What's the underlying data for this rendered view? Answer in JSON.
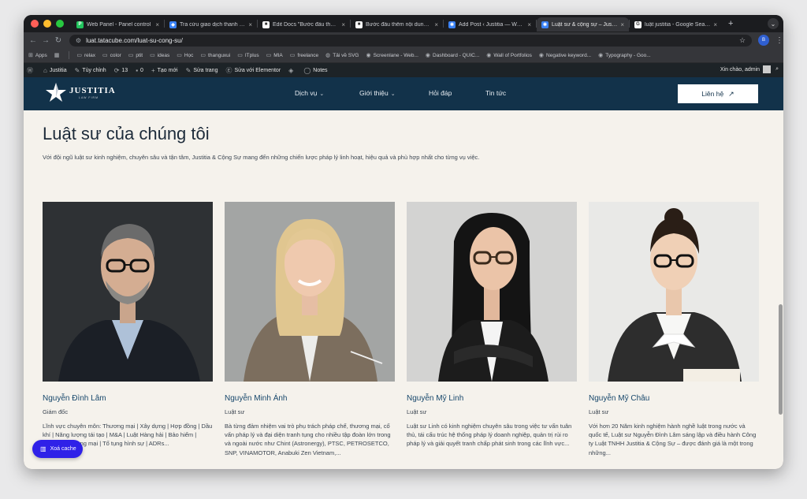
{
  "browser": {
    "tabs": [
      {
        "title": "Web Panel - Panel control",
        "favicon_color": "#22c55e",
        "favicon_glyph": "P",
        "active": false
      },
      {
        "title": "Tra cứu giao dịch thanh toán",
        "favicon_color": "#3b82f6",
        "favicon_glyph": "◆",
        "active": false
      },
      {
        "title": "Edit Docs \"Bước đầu thêm n",
        "favicon_color": "#ffffff",
        "favicon_glyph": "■",
        "active": false
      },
      {
        "title": "Bước đầu thêm nội dung – Tr",
        "favicon_color": "#ffffff",
        "favicon_glyph": "■",
        "active": false
      },
      {
        "title": "Add Post ‹ Justitia — WordP",
        "favicon_color": "#3b82f6",
        "favicon_glyph": "✱",
        "active": false
      },
      {
        "title": "Luật sư & cộng sự – Justitia",
        "favicon_color": "#3b82f6",
        "favicon_glyph": "✱",
        "active": true
      },
      {
        "title": "luật justitia - Google Search",
        "favicon_color": "#ffffff",
        "favicon_glyph": "G",
        "active": false
      }
    ],
    "new_tab": "+",
    "url": "luat.tatacube.com/luat-su-cong-su/",
    "profile_initial": "B"
  },
  "bookmarks": {
    "apps": "Apps",
    "items": [
      {
        "label": "relax",
        "icon": "folder-icon"
      },
      {
        "label": "color",
        "icon": "folder-icon"
      },
      {
        "label": "ptit",
        "icon": "folder-icon"
      },
      {
        "label": "ideas",
        "icon": "folder-icon"
      },
      {
        "label": "Học",
        "icon": "folder-icon"
      },
      {
        "label": "thanguxui",
        "icon": "folder-icon"
      },
      {
        "label": "ITplus",
        "icon": "folder-icon"
      },
      {
        "label": "MIA",
        "icon": "folder-icon"
      },
      {
        "label": "freelance",
        "icon": "folder-icon"
      },
      {
        "label": "Tải về SVG",
        "icon": "globe-icon"
      },
      {
        "label": "Screenlane - Web...",
        "icon": "site-icon"
      },
      {
        "label": "Dashboard - QUIC...",
        "icon": "site-icon"
      },
      {
        "label": "Wall of Portfolios",
        "icon": "site-icon"
      },
      {
        "label": "Negative keyword...",
        "icon": "site-icon"
      },
      {
        "label": "Typography - Goo...",
        "icon": "site-icon"
      }
    ]
  },
  "adminbar": {
    "items": [
      {
        "label": "",
        "icon": "wordpress-icon",
        "glyph": "Ⓦ"
      },
      {
        "label": "Justitia",
        "icon": "home-icon",
        "glyph": "⌂"
      },
      {
        "label": "Tùy chỉnh",
        "icon": "brush-icon",
        "glyph": "✎"
      },
      {
        "label": "13",
        "icon": "refresh-icon",
        "glyph": "⟳"
      },
      {
        "label": "0",
        "icon": "comment-icon",
        "glyph": "▪"
      },
      {
        "label": "Tạo mới",
        "icon": "plus-icon",
        "glyph": "+"
      },
      {
        "label": "Sửa trang",
        "icon": "pencil-icon",
        "glyph": "✎"
      },
      {
        "label": "Sửa với Elementor",
        "icon": "elementor-icon",
        "glyph": "Ⓔ"
      },
      {
        "label": "",
        "icon": "diamond-icon",
        "glyph": "◈"
      },
      {
        "label": "Notes",
        "icon": "notes-icon",
        "glyph": "◯"
      }
    ],
    "greeting": "Xin chào, admin"
  },
  "site": {
    "logo_name": "JUSTITIA",
    "logo_sub": "LAW FIRM",
    "nav": [
      {
        "label": "Dịch vụ",
        "dropdown": true
      },
      {
        "label": "Giới thiệu",
        "dropdown": true
      },
      {
        "label": "Hỏi đáp",
        "dropdown": false
      },
      {
        "label": "Tin tức",
        "dropdown": false
      }
    ],
    "contact_label": "Liên hệ",
    "header_color": "#12324a"
  },
  "page": {
    "title": "Luật sư của chúng tôi",
    "description": "Với đội ngũ luật sư kinh nghiệm, chuyên sâu và tận tâm, Justitia & Cộng Sự mang đến những chiến lược pháp lý linh hoạt, hiệu quả và phù hợp nhất cho từng vụ việc."
  },
  "lawyers": [
    {
      "name": "Nguyễn Đình Lâm",
      "role": "Giám đốc",
      "bio": "Lĩnh vực chuyên môn: Thương mại | Xây dựng | Hợp đồng | Dầu khí | Năng lượng tái tạo | M&A | Luật Hàng hải | Bảo hiểm | Trọng tài thương mại | Tố tụng hình sự | ADRs..."
    },
    {
      "name": "Nguyễn Minh Ánh",
      "role": "Luật sư",
      "bio": "Bà từng đảm nhiệm vai trò phụ trách pháp chế, thương mại, cố vấn pháp lý và đại diện tranh tụng cho nhiều tập đoàn lớn trong và ngoài nước như Chint (Astronergy), PTSC, PETROSETCO, SNP, VINAMOTOR, Anabuki Zen Vietnam,..."
    },
    {
      "name": "Nguyễn Mỹ Linh",
      "role": "Luật sư",
      "bio": "Luật sư Linh có kinh nghiệm chuyên sâu trong việc tư vấn tuân thủ, tái cấu trúc hệ thống pháp lý doanh nghiệp, quản trị rủi ro pháp lý và giải quyết tranh chấp phát sinh trong các lĩnh vực..."
    },
    {
      "name": "Nguyễn Mỹ Châu",
      "role": "Luật sư",
      "bio": "Với hơn 20 Năm kinh nghiệm hành nghề luật trong nước và quốc tế, Luật sư Nguyễn Đình Lâm sáng lập và điều hành Công ty Luật TNHH Justitia & Cộng Sự – được đánh giá là một trong những..."
    }
  ],
  "cache_button": {
    "label": "Xoá cache",
    "color": "#2f21e8"
  }
}
